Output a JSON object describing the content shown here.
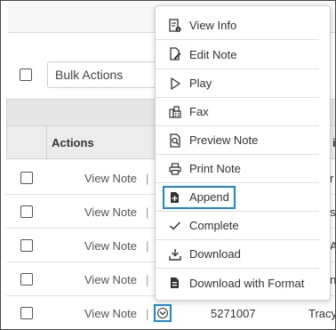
{
  "bulk_actions": {
    "label": "Bulk Actions"
  },
  "table": {
    "header_actions": "Actions",
    "header_clip_right": "ie",
    "rows": [
      {
        "view_note": "View Note",
        "sep": "|",
        "clip": "r"
      },
      {
        "view_note": "View Note",
        "sep": "|",
        "clip": "s"
      },
      {
        "view_note": "View Note",
        "sep": "|",
        "clip": "A"
      },
      {
        "view_note": "View Note",
        "sep": "|",
        "clip": "n"
      },
      {
        "view_note": "View Note",
        "sep": "|",
        "id": "5271007",
        "name": "Tracy"
      }
    ]
  },
  "menu": {
    "items": [
      {
        "label": "View Info",
        "icon": "view-info-icon"
      },
      {
        "label": "Edit Note",
        "icon": "edit-note-icon"
      },
      {
        "label": "Play",
        "icon": "play-icon"
      },
      {
        "label": "Fax",
        "icon": "fax-icon"
      },
      {
        "label": "Preview Note",
        "icon": "preview-icon"
      },
      {
        "label": "Print Note",
        "icon": "print-icon"
      },
      {
        "label": "Append",
        "icon": "append-icon"
      },
      {
        "label": "Complete",
        "icon": "checkmark-icon"
      },
      {
        "label": "Download",
        "icon": "download-icon"
      },
      {
        "label": "Download with Format",
        "icon": "download-format-icon"
      }
    ]
  },
  "colors": {
    "highlight": "#1a8bd9",
    "header_bg": "#ececec"
  }
}
